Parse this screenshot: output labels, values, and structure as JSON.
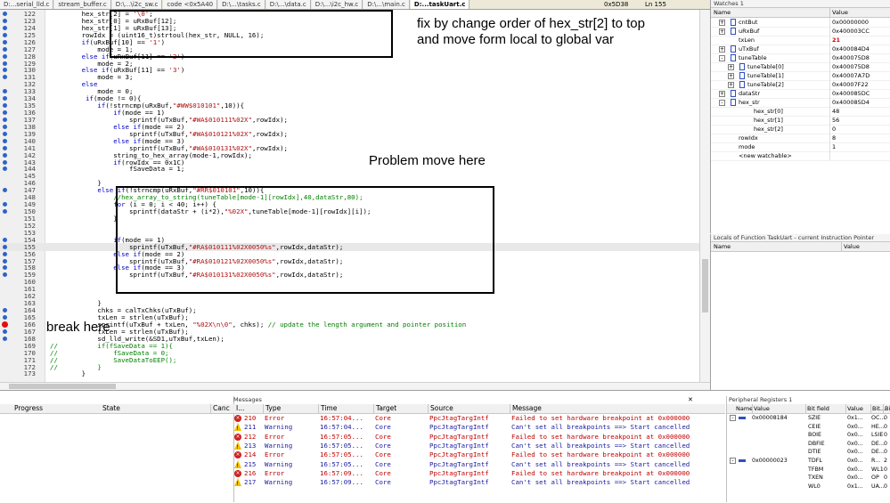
{
  "tabs": [
    {
      "label": "D:...serial_lld.c",
      "active": false
    },
    {
      "label": "stream_buffer.c",
      "active": false
    },
    {
      "label": "D:\\...\\i2c_sw.c",
      "active": false
    },
    {
      "label": "code <0x5A40",
      "active": false
    },
    {
      "label": "D:\\...\\tasks.c",
      "active": false
    },
    {
      "label": "D:\\...\\data.c",
      "active": false
    },
    {
      "label": "D:\\...\\i2c_hw.c",
      "active": false
    },
    {
      "label": "D:\\...\\main.c",
      "active": false
    },
    {
      "label": "D:...taskUart.c",
      "active": true
    }
  ],
  "editor_status": {
    "address": "0x5D38",
    "line": "Ln 155"
  },
  "code_lines": [
    {
      "n": "122",
      "bp": "dot",
      "t": "        hex_str[2] = '\\0';"
    },
    {
      "n": "123",
      "bp": "dot",
      "t": "        hex_str[0] = uRxBuf[12];"
    },
    {
      "n": "124",
      "bp": "dot",
      "t": "        hex_str[1] = uRxBuf[13];"
    },
    {
      "n": "125",
      "bp": "dot",
      "t": "        rowIdx = (uint16_t)strtoul(hex_str, NULL, 16);"
    },
    {
      "n": "126",
      "bp": "dot",
      "t": "        if(uRxBuf[10] == '1')"
    },
    {
      "n": "127",
      "bp": "dot",
      "t": "            mode = 1;"
    },
    {
      "n": "128",
      "bp": "dot",
      "t": "        else if(uRxBuf[11] == '2')"
    },
    {
      "n": "129",
      "bp": "dot",
      "t": "            mode = 2;"
    },
    {
      "n": "130",
      "bp": "dot",
      "t": "        else if(uRxBuf[11] == '3')"
    },
    {
      "n": "131",
      "bp": "dot",
      "t": "            mode = 3;"
    },
    {
      "n": "132",
      "bp": "",
      "t": "        else"
    },
    {
      "n": "133",
      "bp": "dot",
      "t": "            mode = 0;"
    },
    {
      "n": "134",
      "bp": "dot",
      "t": "         if(mode != 0){"
    },
    {
      "n": "135",
      "bp": "dot",
      "t": "            if(!strncmp(uRxBuf,\"#WW$010101\",10)){"
    },
    {
      "n": "136",
      "bp": "dot",
      "t": "                if(mode == 1)"
    },
    {
      "n": "137",
      "bp": "dot",
      "t": "                    sprintf(uTxBuf,\"#WA$010111%02X\",rowIdx);"
    },
    {
      "n": "138",
      "bp": "dot",
      "t": "                else if(mode == 2)"
    },
    {
      "n": "139",
      "bp": "dot",
      "t": "                    sprintf(uTxBuf,\"#WA$010121%02X\",rowIdx);"
    },
    {
      "n": "140",
      "bp": "dot",
      "t": "                else if(mode == 3)"
    },
    {
      "n": "141",
      "bp": "dot",
      "t": "                    sprintf(uTxBuf,\"#WA$010131%02X\",rowIdx);"
    },
    {
      "n": "142",
      "bp": "dot",
      "t": "                string_to_hex_array(mode-1,rowIdx);"
    },
    {
      "n": "143",
      "bp": "dot",
      "t": "                if(rowIdx == 0x1C)"
    },
    {
      "n": "144",
      "bp": "dot",
      "t": "                    fSaveData = 1;"
    },
    {
      "n": "145",
      "bp": "",
      "t": ""
    },
    {
      "n": "146",
      "bp": "",
      "t": "            }"
    },
    {
      "n": "147",
      "bp": "dot",
      "t": "            else if(!strncmp(uRxBuf,\"#RR$010101\",10)){"
    },
    {
      "n": "148",
      "bp": "",
      "t": "                //hex_array_to_string(tuneTable[mode-1][rowIdx],40,dataStr,80);"
    },
    {
      "n": "149",
      "bp": "dot",
      "t": "                for (i = 0; i < 40; i++) {"
    },
    {
      "n": "150",
      "bp": "dot",
      "t": "                    sprintf(dataStr + (i*2),\"%02X\",tuneTable[mode-1][rowIdx][i]);"
    },
    {
      "n": "151",
      "bp": "",
      "t": "                }"
    },
    {
      "n": "152",
      "bp": "",
      "t": ""
    },
    {
      "n": "153",
      "bp": "",
      "t": ""
    },
    {
      "n": "154",
      "bp": "dot",
      "t": "                if(mode == 1)"
    },
    {
      "n": "155",
      "bp": "dot",
      "t": "                    sprintf(uTxBuf,\"#RA$010111%02X0050%s\",rowIdx,dataStr);"
    },
    {
      "n": "156",
      "bp": "dot",
      "t": "                else if(mode == 2)"
    },
    {
      "n": "157",
      "bp": "dot",
      "t": "                    sprintf(uTxBuf,\"#RA$010121%02X0050%s\",rowIdx,dataStr);"
    },
    {
      "n": "158",
      "bp": "dot",
      "t": "                else if(mode == 3)"
    },
    {
      "n": "159",
      "bp": "dot",
      "t": "                    sprintf(uTxBuf,\"#RA$010131%02X0050%s\",rowIdx,dataStr);"
    },
    {
      "n": "160",
      "bp": "",
      "t": ""
    },
    {
      "n": "161",
      "bp": "",
      "t": ""
    },
    {
      "n": "162",
      "bp": "",
      "t": ""
    },
    {
      "n": "163",
      "bp": "",
      "t": "            }"
    },
    {
      "n": "164",
      "bp": "dot",
      "t": "            chks = calTxChks(uTxBuf);"
    },
    {
      "n": "165",
      "bp": "dot",
      "t": "            txLen = strlen(uTxBuf);"
    },
    {
      "n": "166",
      "bp": "red",
      "t": "            sprintf(uTxBuf + txLen, \"%02X\\n\\0\", chks); // update the length argument and pointer position"
    },
    {
      "n": "167",
      "bp": "dot",
      "t": "            txLen = strlen(uTxBuf);"
    },
    {
      "n": "168",
      "bp": "dot",
      "t": "            sd_lld_write(&SD1,uTxBuf,txLen);"
    },
    {
      "n": "169",
      "bp": "",
      "t": "//          if(fSaveData == 1){"
    },
    {
      "n": "170",
      "bp": "",
      "t": "//              fSaveData = 0;"
    },
    {
      "n": "171",
      "bp": "",
      "t": "//              SaveDataToEEP();"
    },
    {
      "n": "172",
      "bp": "",
      "t": "//          }"
    },
    {
      "n": "173",
      "bp": "",
      "t": "        }"
    }
  ],
  "annotations": {
    "fix_note": "fix by change order of hex_str[2] to top\nand move form local to global var",
    "problem_note": "Problem move here",
    "break_note": "break here"
  },
  "watch": {
    "title": "Watches 1",
    "col_name": "Name",
    "col_value": "Value",
    "rows": [
      {
        "name": "cntBut",
        "value": "0x00000000",
        "indent": 0,
        "pm": "+",
        "icon": true,
        "red": false
      },
      {
        "name": "uRxBuf",
        "value": "0x400003CC",
        "indent": 0,
        "pm": "+",
        "icon": true,
        "red": false
      },
      {
        "name": "txLen",
        "value": "21",
        "indent": 0,
        "pm": "",
        "icon": false,
        "red": true
      },
      {
        "name": "uTxBuf",
        "value": "0x400084D4",
        "indent": 0,
        "pm": "+",
        "icon": true,
        "red": false
      },
      {
        "name": "tuneTable",
        "value": "0x400075D8",
        "indent": 0,
        "pm": "-",
        "icon": true,
        "red": false
      },
      {
        "name": "tuneTable[0]",
        "value": "0x400075D8",
        "indent": 1,
        "pm": "+",
        "icon": true,
        "red": false
      },
      {
        "name": "tuneTable[1]",
        "value": "0x40007A7D",
        "indent": 1,
        "pm": "+",
        "icon": true,
        "red": false
      },
      {
        "name": "tuneTable[2]",
        "value": "0x40007F22",
        "indent": 1,
        "pm": "+",
        "icon": true,
        "red": false
      },
      {
        "name": "dataStr",
        "value": "0x400085DC",
        "indent": 0,
        "pm": "+",
        "icon": true,
        "red": false
      },
      {
        "name": "hex_str",
        "value": "0x400085D4",
        "indent": 0,
        "pm": "-",
        "icon": true,
        "red": false
      },
      {
        "name": "hex_str[0]",
        "value": "48",
        "indent": 2,
        "pm": "",
        "icon": false,
        "red": false
      },
      {
        "name": "hex_str[1]",
        "value": "56",
        "indent": 2,
        "pm": "",
        "icon": false,
        "red": false
      },
      {
        "name": "hex_str[2]",
        "value": "0",
        "indent": 2,
        "pm": "",
        "icon": false,
        "red": false
      },
      {
        "name": "rowIdx",
        "value": "8",
        "indent": 0,
        "pm": "",
        "icon": false,
        "red": false
      },
      {
        "name": "mode",
        "value": "1",
        "indent": 0,
        "pm": "",
        "icon": false,
        "red": false
      },
      {
        "name": "<new watchable>",
        "value": "",
        "indent": 0,
        "pm": "",
        "icon": false,
        "red": false
      }
    ]
  },
  "locals": {
    "title": "Locals of Function TaskUart - current Instruction Pointer",
    "col_name": "Name",
    "col_value": "Value"
  },
  "progress": {
    "col_progress": "Progress",
    "col_state": "State",
    "col_cancel": "Canc"
  },
  "messages": {
    "title": "Messages",
    "cols": [
      "I...",
      "Type",
      "Time",
      "Target",
      "Source",
      "Message"
    ],
    "rows": [
      {
        "id": "210",
        "type": "Error",
        "time": "16:57:04...",
        "target": "Core",
        "source": "PpcJtagTargIntf",
        "message": "Failed to set hardware breakpoint at 0x000000"
      },
      {
        "id": "211",
        "type": "Warning",
        "time": "16:57:04...",
        "target": "Core",
        "source": "PpcJtagTargIntf",
        "message": "Can't set all breakpoints ==> Start cancelled"
      },
      {
        "id": "212",
        "type": "Error",
        "time": "16:57:05...",
        "target": "Core",
        "source": "PpcJtagTargIntf",
        "message": "Failed to set hardware breakpoint at 0x000000"
      },
      {
        "id": "213",
        "type": "Warning",
        "time": "16:57:05...",
        "target": "Core",
        "source": "PpcJtagTargIntf",
        "message": "Can't set all breakpoints ==> Start cancelled"
      },
      {
        "id": "214",
        "type": "Error",
        "time": "16:57:05...",
        "target": "Core",
        "source": "PpcJtagTargIntf",
        "message": "Failed to set hardware breakpoint at 0x000000"
      },
      {
        "id": "215",
        "type": "Warning",
        "time": "16:57:05...",
        "target": "Core",
        "source": "PpcJtagTargIntf",
        "message": "Can't set all breakpoints ==> Start cancelled"
      },
      {
        "id": "216",
        "type": "Error",
        "time": "16:57:09...",
        "target": "Core",
        "source": "PpcJtagTargIntf",
        "message": "Failed to set hardware breakpoint at 0x000000"
      },
      {
        "id": "217",
        "type": "Warning",
        "time": "16:57:09...",
        "target": "Core",
        "source": "PpcJtagTargIntf",
        "message": "Can't set all breakpoints ==> Start cancelled"
      }
    ]
  },
  "peripheral": {
    "title": "Peripheral Registers 1",
    "cols": [
      "Name",
      "Value",
      "Bit field",
      "Value",
      "Bit...",
      "Bit"
    ],
    "rows": [
      {
        "pm": "-",
        "name": "0x00008184",
        "field": "SZIE",
        "val": "0x1...",
        "bit": "OC...",
        "bit2": "0"
      },
      {
        "pm": "",
        "name": "",
        "field": "CEIE",
        "val": "0x0...",
        "bit": "HE...",
        "bit2": "0"
      },
      {
        "pm": "",
        "name": "",
        "field": "BOIE",
        "val": "0x0...",
        "bit": "LSIE",
        "bit2": "0"
      },
      {
        "pm": "",
        "name": "",
        "field": "DBFIE",
        "val": "0x0...",
        "bit": "DE...",
        "bit2": "0"
      },
      {
        "pm": "",
        "name": "",
        "field": "DTIE",
        "val": "0x0...",
        "bit": "DE...",
        "bit2": "0"
      },
      {
        "pm": "-",
        "name": "0x00000023",
        "field": "TDFL",
        "val": "0x0...",
        "bit": "R...",
        "bit2": "2"
      },
      {
        "pm": "",
        "name": "",
        "field": "TFBM",
        "val": "0x0...",
        "bit": "WL1",
        "bit2": "0"
      },
      {
        "pm": "",
        "name": "",
        "field": "TXEN",
        "val": "0x0...",
        "bit": "OP",
        "bit2": "0"
      },
      {
        "pm": "",
        "name": "",
        "field": "WL0",
        "val": "0x1...",
        "bit": "UA...",
        "bit2": "0"
      }
    ]
  }
}
